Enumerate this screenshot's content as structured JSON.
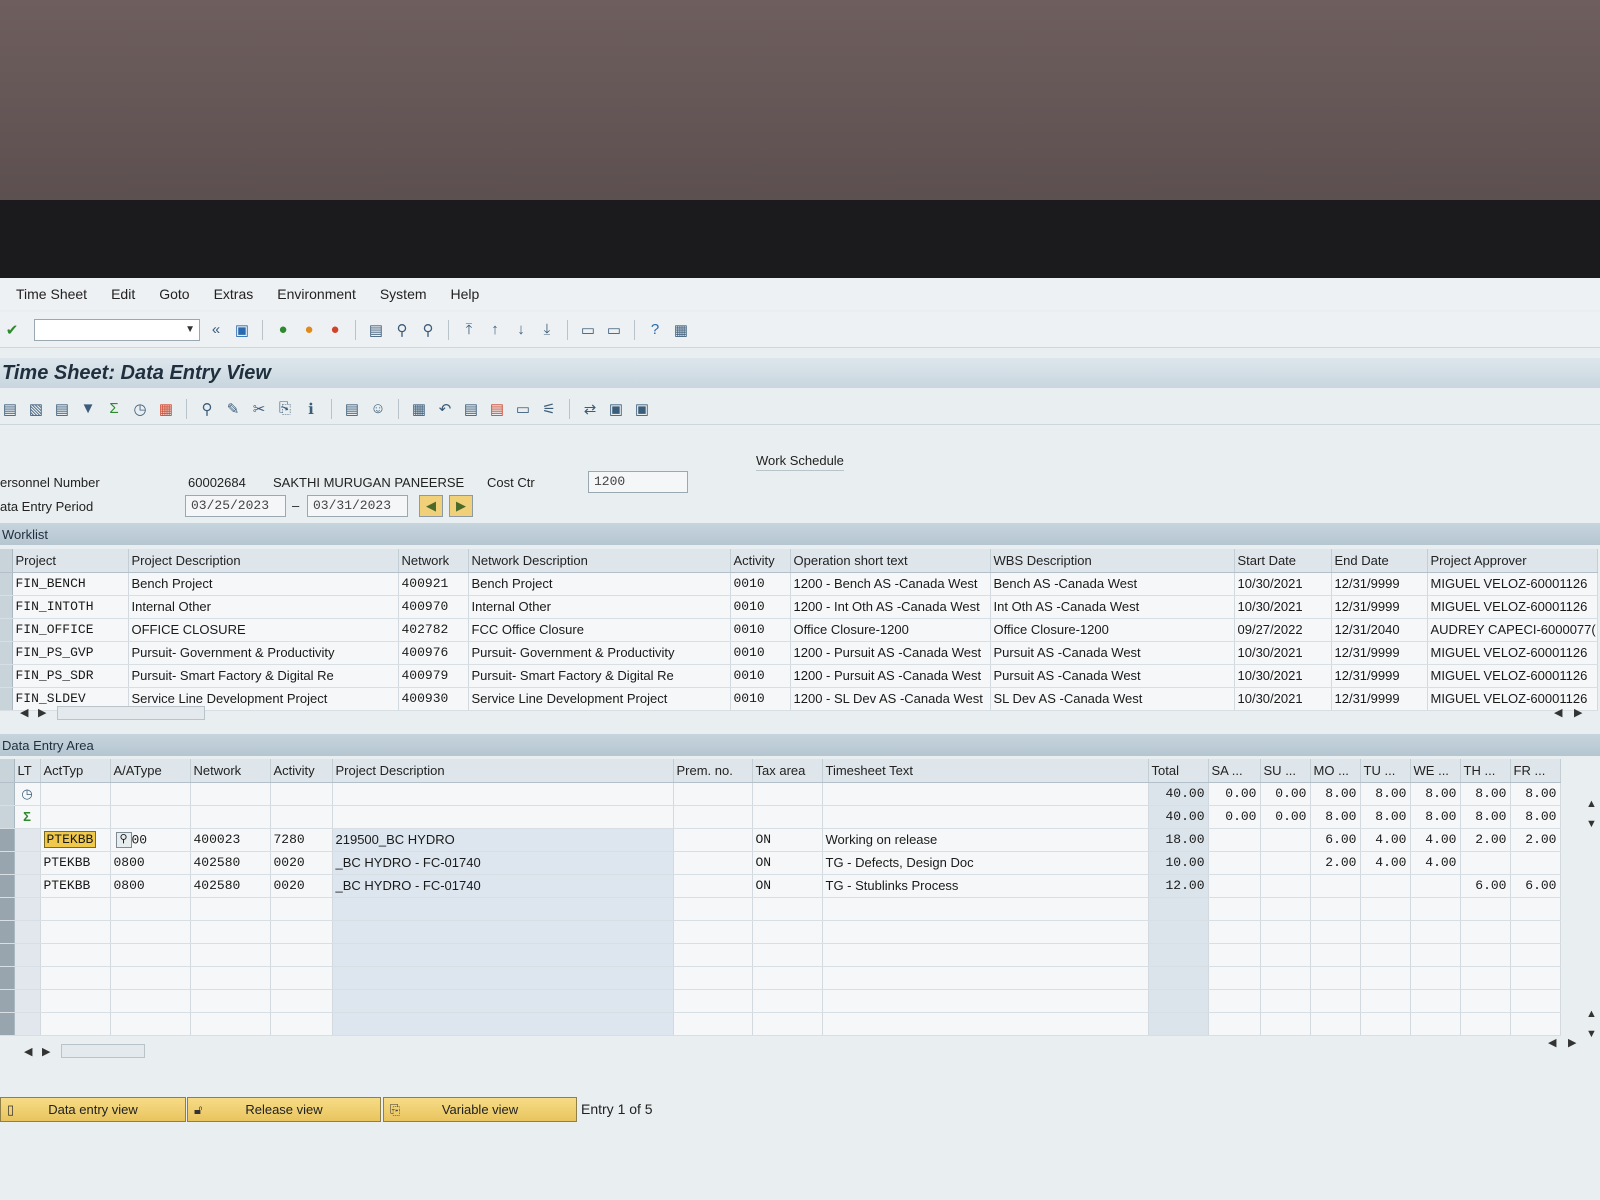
{
  "menu": [
    "Time Sheet",
    "Edit",
    "Goto",
    "Extras",
    "Environment",
    "System",
    "Help"
  ],
  "page_title": "Time Sheet: Data Entry View",
  "header": {
    "personnel_label": "ersonnel Number",
    "personnel_number": "60002684",
    "employee_name": "SAKTHI MURUGAN PANEERSE",
    "cost_ctr_label": "Cost Ctr",
    "cost_ctr": "1200",
    "period_label": "ata Entry Period",
    "period_from": "03/25/2023",
    "period_sep": "–",
    "period_to": "03/31/2023",
    "work_schedule": "Work Schedule"
  },
  "worklist": {
    "title": "Worklist",
    "columns": [
      "Project",
      "Project Description",
      "Network",
      "Network Description",
      "Activity",
      "Operation short text",
      "WBS Description",
      "Start Date",
      "End Date",
      "Project Approver"
    ],
    "rows": [
      [
        "FIN_BENCH",
        "Bench Project",
        "400921",
        "Bench Project",
        "0010",
        "1200 - Bench AS -Canada West",
        "Bench AS -Canada West",
        "10/30/2021",
        "12/31/9999",
        "MIGUEL VELOZ-60001126"
      ],
      [
        "FIN_INTOTH",
        "Internal Other",
        "400970",
        "Internal Other",
        "0010",
        "1200 - Int Oth AS -Canada West",
        "Int Oth AS -Canada West",
        "10/30/2021",
        "12/31/9999",
        "MIGUEL VELOZ-60001126"
      ],
      [
        "FIN_OFFICE",
        "OFFICE CLOSURE",
        "402782",
        "FCC Office Closure",
        "0010",
        "Office Closure-1200",
        "Office Closure-1200",
        "09/27/2022",
        "12/31/2040",
        "AUDREY CAPECI-6000077("
      ],
      [
        "FIN_PS_GVP",
        "Pursuit- Government & Productivity",
        "400976",
        "Pursuit- Government & Productivity",
        "0010",
        "1200 - Pursuit AS -Canada West",
        "Pursuit AS -Canada West",
        "10/30/2021",
        "12/31/9999",
        "MIGUEL VELOZ-60001126"
      ],
      [
        "FIN_PS_SDR",
        "Pursuit- Smart Factory & Digital Re",
        "400979",
        "Pursuit- Smart Factory & Digital Re",
        "0010",
        "1200 - Pursuit AS -Canada West",
        "Pursuit AS -Canada West",
        "10/30/2021",
        "12/31/9999",
        "MIGUEL VELOZ-60001126"
      ],
      [
        "FIN_SLDEV",
        "Service Line Development Project",
        "400930",
        "Service Line Development Project",
        "0010",
        "1200 - SL Dev AS -Canada West",
        "SL Dev AS -Canada West",
        "10/30/2021",
        "12/31/9999",
        "MIGUEL VELOZ-60001126"
      ]
    ]
  },
  "entry_area": {
    "title": "Data Entry Area",
    "columns": [
      "LT",
      "ActTyp",
      "A/AType",
      "Network",
      "Activity",
      "Project Description",
      "Prem. no.",
      "Tax area",
      "Timesheet Text",
      "Total",
      "SA",
      "...",
      "SU",
      "...",
      "MO",
      "...",
      "TU",
      "...",
      "WE",
      "...",
      "TH",
      "...",
      "FR",
      "..."
    ],
    "target_row": [
      "40.00",
      "0.00",
      "0.00",
      "8.00",
      "8.00",
      "8.00",
      "8.00",
      "8.00"
    ],
    "sum_row": [
      "40.00",
      "0.00",
      "0.00",
      "8.00",
      "8.00",
      "8.00",
      "8.00",
      "8.00"
    ],
    "rows": [
      {
        "acttyp": "PTEKBB",
        "aatype": "00",
        "network": "400023",
        "activity": "7280",
        "desc": "219500_BC HYDRO",
        "tax": "ON",
        "text": "Working on release",
        "total": "18.00",
        "days": [
          "",
          "",
          "6.00",
          "4.00",
          "4.00",
          "2.00",
          "2.00"
        ]
      },
      {
        "acttyp": "PTEKBB",
        "aatype": "0800",
        "network": "402580",
        "activity": "0020",
        "desc": "_BC HYDRO - FC-01740",
        "tax": "ON",
        "text": "TG - Defects, Design Doc",
        "total": "10.00",
        "days": [
          "",
          "",
          "2.00",
          "4.00",
          "4.00",
          "",
          ""
        ]
      },
      {
        "acttyp": "PTEKBB",
        "aatype": "0800",
        "network": "402580",
        "activity": "0020",
        "desc": "_BC HYDRO - FC-01740",
        "tax": "ON",
        "text": "TG -  Stublinks Process",
        "total": "12.00",
        "days": [
          "",
          "",
          "",
          "",
          "",
          "6.00",
          "6.00"
        ]
      }
    ]
  },
  "buttons": {
    "data_entry_view": "Data entry view",
    "release_view": "Release view",
    "variable_view": "Variable view"
  },
  "entry_info": "Entry 1 of 5"
}
